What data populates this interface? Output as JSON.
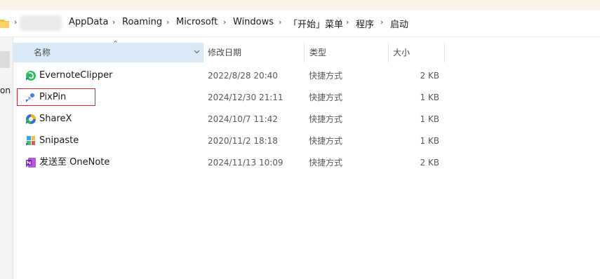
{
  "address_bar": {
    "breadcrumbs": [
      "AppData",
      "Roaming",
      "Microsoft",
      "Windows",
      "「开始」菜单",
      "程序",
      "启动"
    ],
    "separator": "›"
  },
  "nav_pane": {
    "truncated_label": "ona"
  },
  "columns": {
    "name": "名称",
    "modified": "修改日期",
    "type": "类型",
    "size": "大小"
  },
  "files": [
    {
      "name": "EvernoteClipper",
      "modified": "2022/8/28 20:40",
      "type": "快捷方式",
      "size": "2 KB",
      "icon": "evernote-clipper-icon"
    },
    {
      "name": "PixPin",
      "modified": "2024/12/30 21:11",
      "type": "快捷方式",
      "size": "1 KB",
      "icon": "pixpin-icon"
    },
    {
      "name": "ShareX",
      "modified": "2024/10/7 11:42",
      "type": "快捷方式",
      "size": "1 KB",
      "icon": "sharex-icon"
    },
    {
      "name": "Snipaste",
      "modified": "2020/11/2 18:18",
      "type": "快捷方式",
      "size": "1 KB",
      "icon": "snipaste-icon"
    },
    {
      "name": "发送至 OneNote",
      "modified": "2024/11/13 10:09",
      "type": "快捷方式",
      "size": "2 KB",
      "icon": "onenote-icon"
    }
  ],
  "colors": {
    "sorted_header": "#dbeaf7",
    "highlight_box": "#d12a2a",
    "top_strip": "#fbf3ea"
  }
}
